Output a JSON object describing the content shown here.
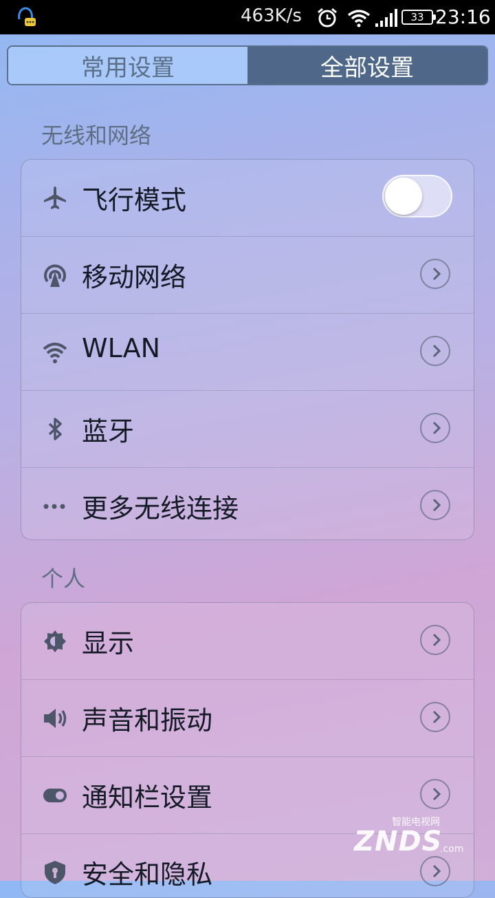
{
  "status_bar": {
    "app_icon": "qq-chat-icon",
    "network_speed": "463K/s",
    "alarm_icon": "alarm-clock-icon",
    "wifi_icon": "wifi-icon",
    "signal_icon": "signal-bars-icon",
    "battery_level": "33",
    "time": "23:16"
  },
  "tabs": {
    "common": "常用设置",
    "all": "全部设置",
    "selected": "all"
  },
  "sections": {
    "wireless": {
      "title": "无线和网络",
      "items": [
        {
          "label": "飞行模式",
          "icon": "airplane-icon",
          "control": "toggle",
          "toggle_on": false
        },
        {
          "label": "移动网络",
          "icon": "cellular-antenna-icon",
          "control": "chevron"
        },
        {
          "label": "WLAN",
          "icon": "wifi-icon",
          "control": "chevron"
        },
        {
          "label": "蓝牙",
          "icon": "bluetooth-icon",
          "control": "chevron"
        },
        {
          "label": "更多无线连接",
          "icon": "more-dots-icon",
          "control": "chevron"
        }
      ]
    },
    "personal": {
      "title": "个人",
      "items": [
        {
          "label": "显示",
          "icon": "brightness-icon",
          "control": "chevron"
        },
        {
          "label": "声音和振动",
          "icon": "speaker-icon",
          "control": "chevron"
        },
        {
          "label": "通知栏设置",
          "icon": "notification-toggle-icon",
          "control": "chevron"
        },
        {
          "label": "安全和隐私",
          "icon": "shield-lock-icon",
          "control": "chevron"
        }
      ]
    }
  },
  "watermark": {
    "small": "智能电视网",
    "big": "ZNDS",
    "suffix": ".com"
  },
  "colors": {
    "active_tab": "#4f6889",
    "inactive_tab": "#aacdfa",
    "section_title": "#5f6f83",
    "label": "#141a26"
  }
}
